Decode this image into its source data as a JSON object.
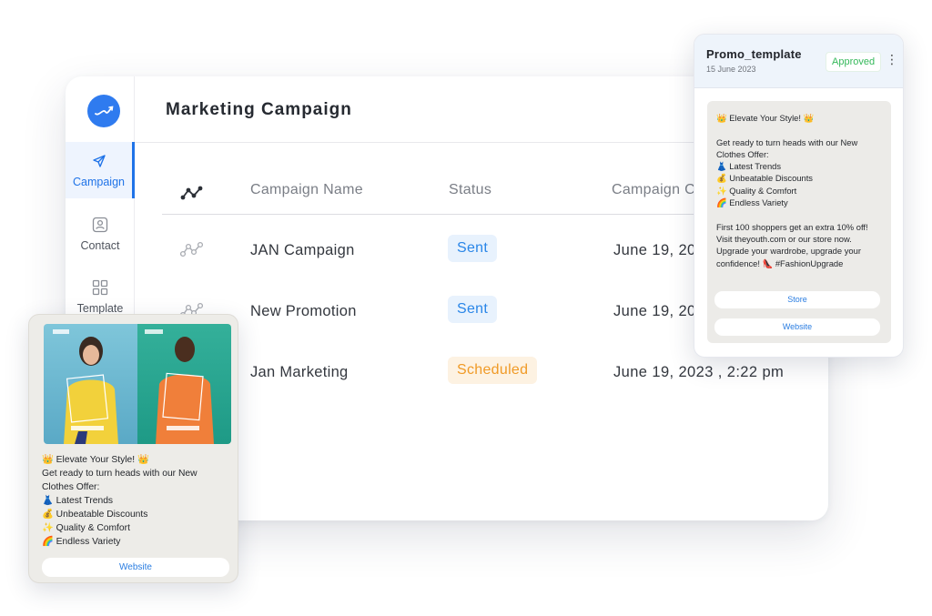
{
  "sidebar": {
    "items": [
      {
        "label": "Campaign",
        "icon": "send-icon",
        "active": true
      },
      {
        "label": "Contact",
        "icon": "contact-icon",
        "active": false
      },
      {
        "label": "Template",
        "icon": "grid-icon",
        "active": false
      }
    ]
  },
  "main": {
    "title": "Marketing Campaign",
    "columns": [
      "Campaign Name",
      "Status",
      "Campaign C"
    ],
    "rows": [
      {
        "name": "JAN Campaign",
        "status": "Sent",
        "date": "June 19, 202"
      },
      {
        "name": "New Promotion",
        "status": "Sent",
        "date": "June 19, 202"
      },
      {
        "name": "Jan Marketing",
        "status": "Scheduled",
        "date": "June 19, 2023 , 2:22 pm"
      }
    ]
  },
  "promo_card": {
    "name": "Promo_template",
    "date": "15 June 2023",
    "badge": "Approved",
    "message": "👑 Elevate Your Style! 👑\n\nGet ready to turn heads with our New Clothes Offer:\n👗 Latest Trends\n💰 Unbeatable Discounts\n✨ Quality & Comfort\n🌈 Endless Variety\n\nFirst 100 shoppers get an extra 10% off! Visit theyouth.com or our store now. Upgrade your wardrobe, upgrade your confidence! 👠 #FashionUpgrade",
    "buttons": [
      "Store",
      "Website"
    ]
  },
  "image_card": {
    "message": "👑 Elevate Your Style! 👑\n Get ready to turn heads with our New Clothes Offer:\n👗 Latest Trends\n💰 Unbeatable Discounts\n✨ Quality & Comfort\n🌈 Endless Variety",
    "button": "Website"
  },
  "colors": {
    "accent": "#1f73e8",
    "sent": "#2a86e8",
    "scheduled": "#f09a26",
    "approved": "#35b85a"
  }
}
